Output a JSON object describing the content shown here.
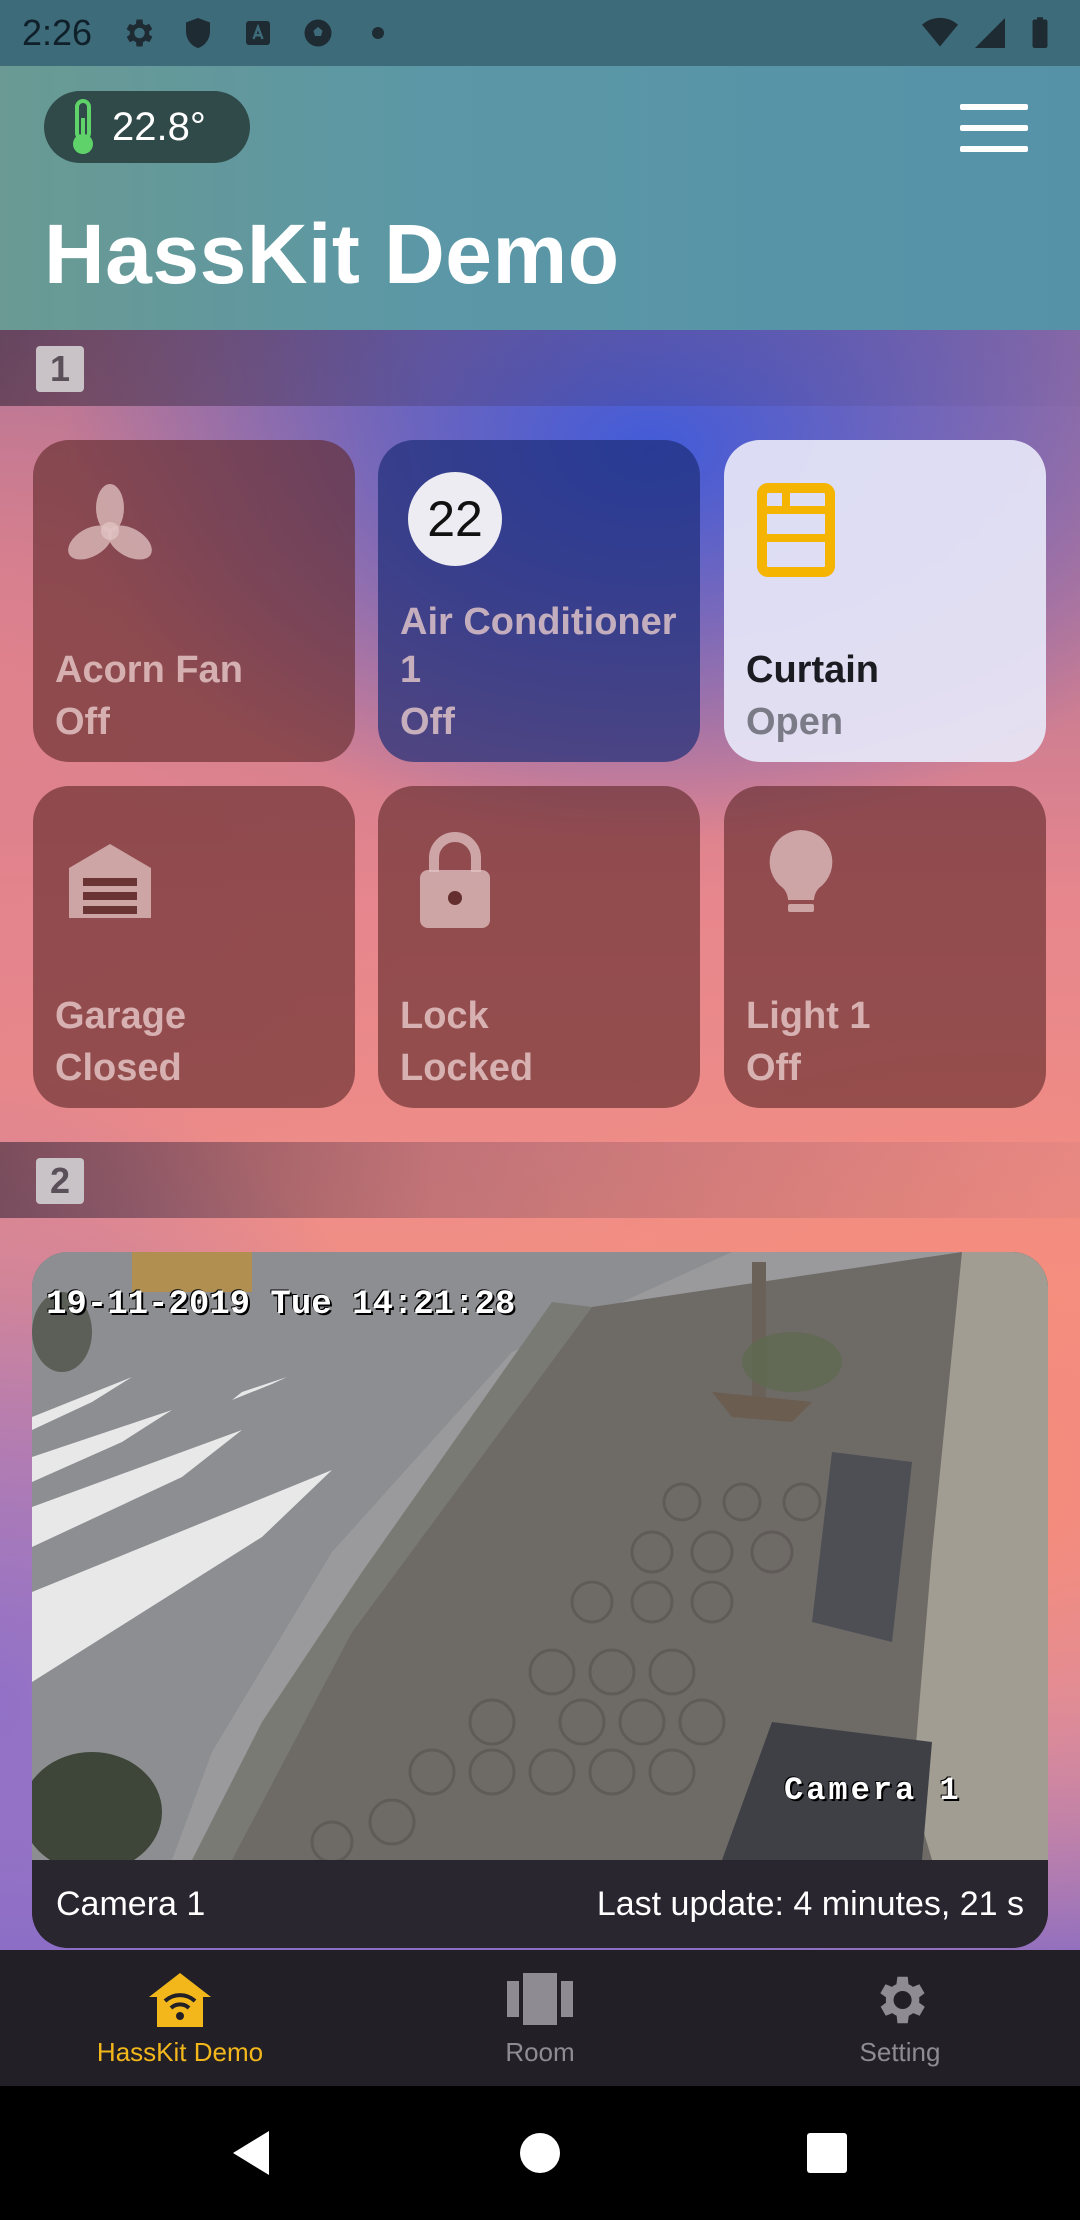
{
  "status_bar": {
    "time": "2:26"
  },
  "header": {
    "temperature": "22.8°",
    "title": "HassKit Demo"
  },
  "sections": [
    {
      "number": "1"
    },
    {
      "number": "2"
    }
  ],
  "tiles": [
    {
      "name": "Acorn Fan",
      "state": "Off",
      "icon": "fan-icon"
    },
    {
      "name": "Air Conditioner 1",
      "state": "Off",
      "badge": "22",
      "icon": "thermostat-badge"
    },
    {
      "name": "Curtain",
      "state": "Open",
      "icon": "curtain-icon",
      "accent": "#f5b400"
    },
    {
      "name": "Garage",
      "state": "Closed",
      "icon": "garage-icon"
    },
    {
      "name": "Lock",
      "state": "Locked",
      "icon": "lock-icon"
    },
    {
      "name": "Light 1",
      "state": "Off",
      "icon": "bulb-icon"
    }
  ],
  "camera": {
    "osd_timestamp": "19-11-2019 Tue 14:21:28",
    "osd_label": "Camera 1",
    "name": "Camera 1",
    "last_update": "Last update: 4 minutes, 21 s"
  },
  "bottom_nav": [
    {
      "label": "HassKit Demo",
      "icon": "home-wifi-icon",
      "active": true
    },
    {
      "label": "Room",
      "icon": "room-carousel-icon",
      "active": false
    },
    {
      "label": "Setting",
      "icon": "gear-icon",
      "active": false
    }
  ],
  "colors": {
    "accent": "#f3b71c",
    "header_bg": "#5b97a6"
  }
}
